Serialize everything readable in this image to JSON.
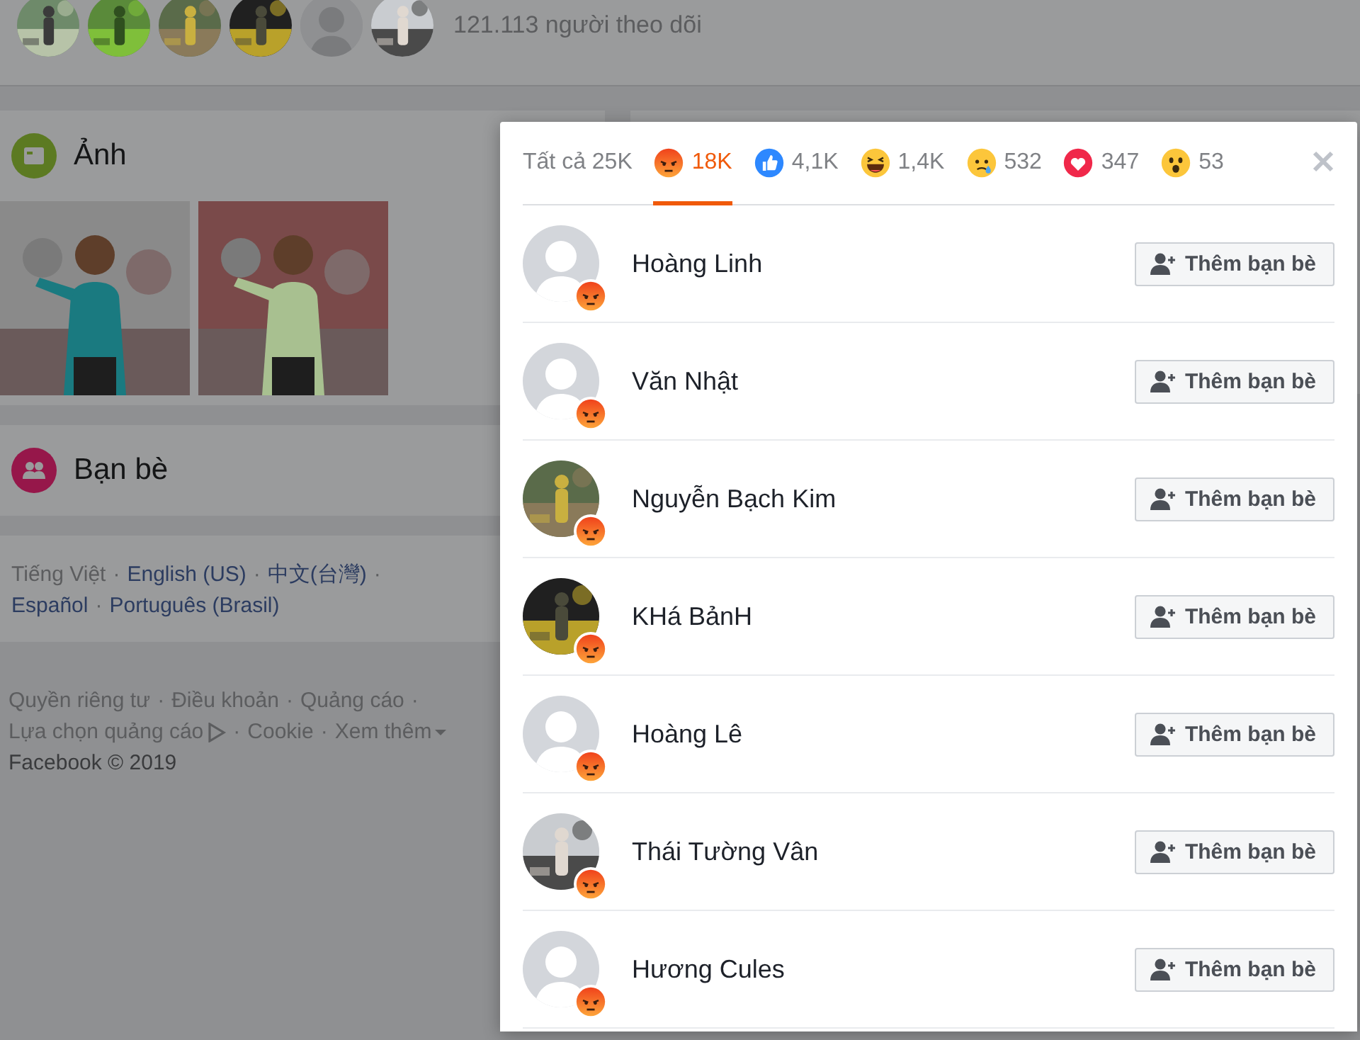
{
  "followers": {
    "avatars": [
      {
        "kind": "picture"
      },
      {
        "kind": "picture"
      },
      {
        "kind": "picture"
      },
      {
        "kind": "picture"
      },
      {
        "kind": "silhouette"
      },
      {
        "kind": "picture"
      }
    ],
    "count": "121.113 người theo dõi"
  },
  "sections": [
    {
      "kind": "photos",
      "title": "Ảnh",
      "photos": [
        {
          "kind": "picture"
        },
        {
          "kind": "picture"
        }
      ]
    },
    {
      "kind": "friends",
      "title": "Bạn bè"
    }
  ],
  "separator": "·",
  "languages": [
    [
      {
        "label": "Tiếng Việt",
        "current": true
      },
      {
        "label": "English (US)",
        "current": false
      },
      {
        "label": "中文(台灣)",
        "current": false
      }
    ],
    [
      {
        "label": "Español",
        "current": false
      },
      {
        "label": "Português (Brasil)",
        "current": false
      }
    ]
  ],
  "footer_links": [
    [
      {
        "label": "Quyền riêng tư"
      },
      {
        "label": "Điều khoản"
      },
      {
        "label": "Quảng cáo"
      }
    ],
    [
      {
        "label": "Lựa chọn quảng cáo",
        "kind": "ad"
      },
      {
        "label": "Cookie"
      },
      {
        "label": "Xem thêm",
        "kind": "menu"
      }
    ]
  ],
  "copyright": "Facebook © 2019",
  "modal": {
    "tabs": [
      {
        "label": "Tất cả 25K",
        "kind": "all",
        "selected": false
      },
      {
        "label": "18K",
        "kind": "angry",
        "selected": true
      },
      {
        "label": "4,1K",
        "kind": "like",
        "selected": false
      },
      {
        "label": "1,4K",
        "kind": "haha",
        "selected": false
      },
      {
        "label": "532",
        "kind": "sad",
        "selected": false
      },
      {
        "label": "347",
        "kind": "love",
        "selected": false
      },
      {
        "label": "53",
        "kind": "wow",
        "selected": false
      }
    ],
    "rows": [
      {
        "name": "Hoàng Linh",
        "kind": "silhouette",
        "button": "Thêm bạn bè"
      },
      {
        "name": "Văn Nhật",
        "kind": "silhouette",
        "button": "Thêm bạn bè"
      },
      {
        "name": "Nguyễn Bạch Kim",
        "kind": "picture",
        "button": "Thêm bạn bè"
      },
      {
        "name": "KHá BảnH",
        "kind": "picture",
        "button": "Thêm bạn bè"
      },
      {
        "name": "Hoàng Lê",
        "kind": "silhouette",
        "button": "Thêm bạn bè"
      },
      {
        "name": "Thái Tường Vân",
        "kind": "picture",
        "button": "Thêm bạn bè"
      },
      {
        "name": "Hương Cules",
        "kind": "silhouette",
        "button": "Thêm bạn bè"
      }
    ]
  }
}
